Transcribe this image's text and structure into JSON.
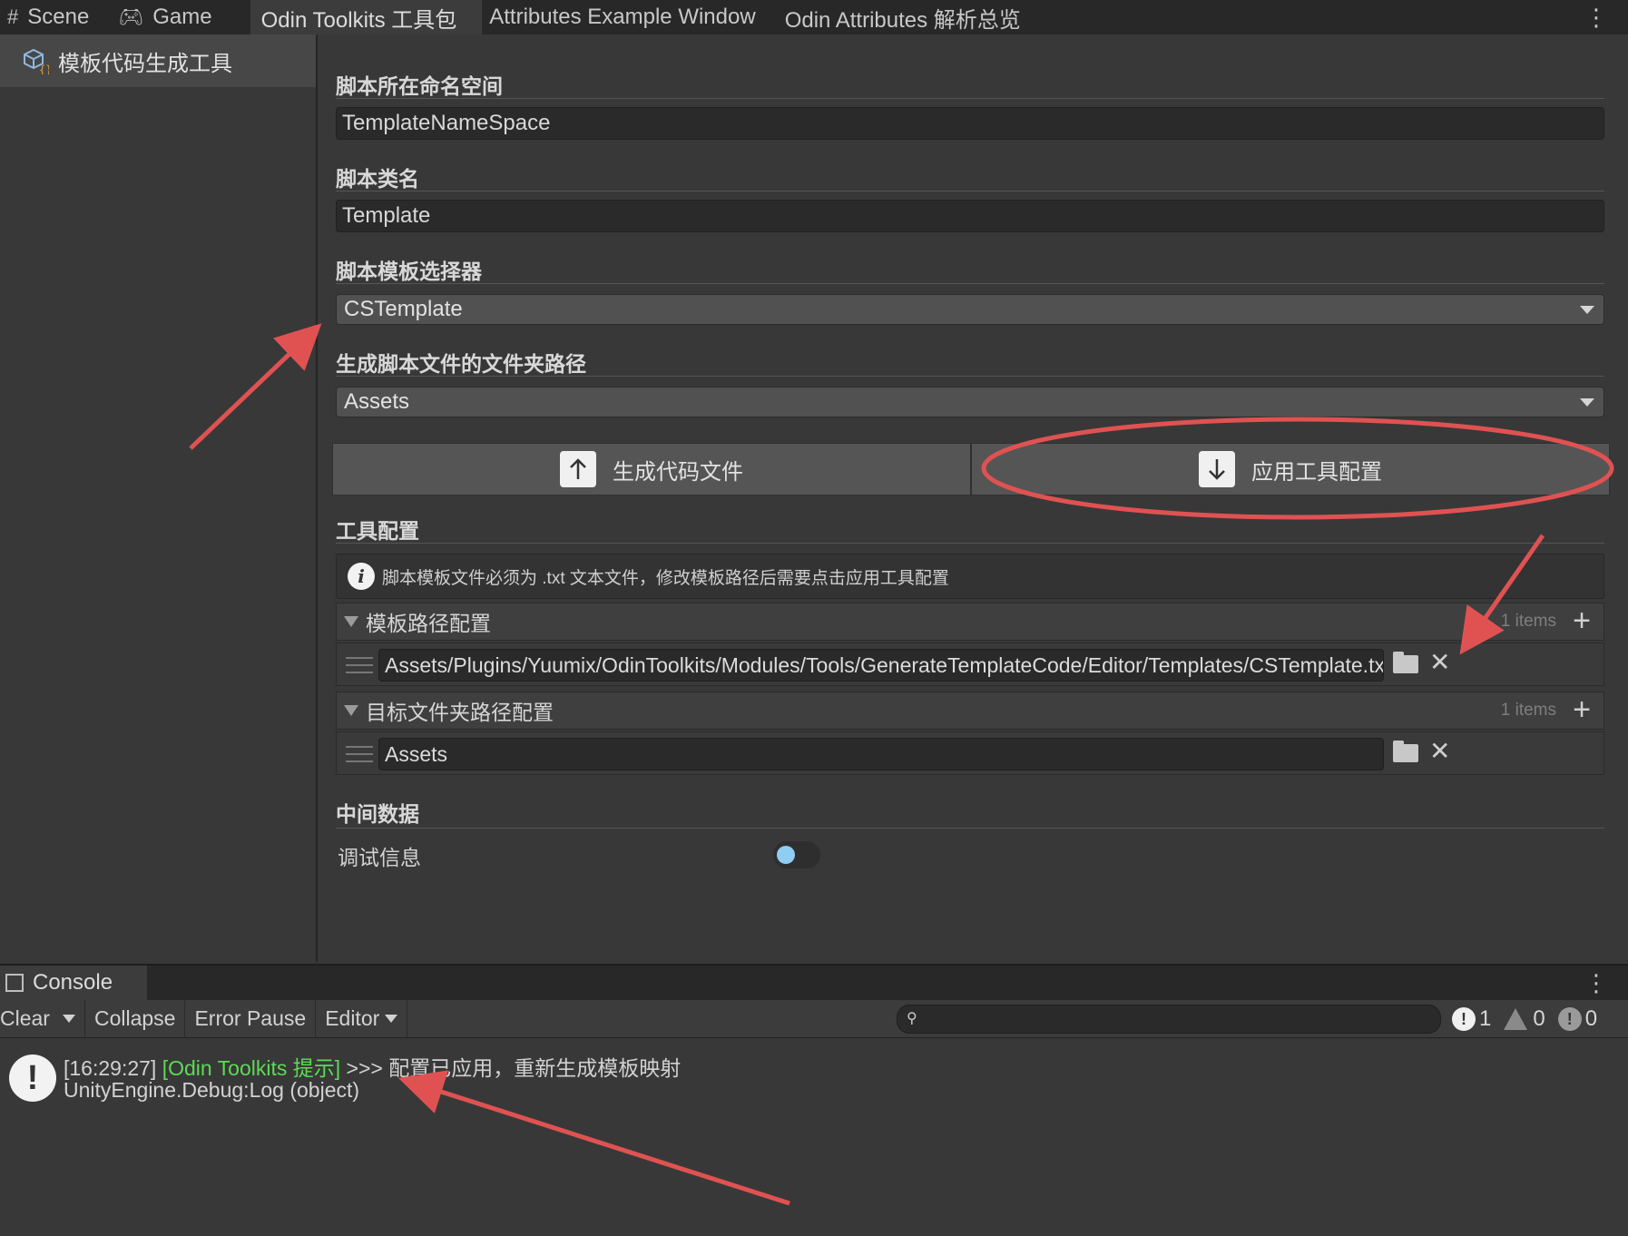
{
  "tabs": [
    {
      "label": "Scene",
      "icon": "grid-icon"
    },
    {
      "label": "Game",
      "icon": "gamepad-icon"
    },
    {
      "label": "Odin Toolkits 工具包",
      "active": true
    },
    {
      "label": "Attributes Example Window"
    },
    {
      "label": "Odin Attributes 解析总览"
    }
  ],
  "sidebar": {
    "items": [
      {
        "label": "模板代码生成工具",
        "icon": "cube-code-icon",
        "selected": true
      }
    ]
  },
  "main": {
    "namespace": {
      "label": "脚本所在命名空间",
      "value": "TemplateNameSpace"
    },
    "classname": {
      "label": "脚本类名",
      "value": "Template"
    },
    "template_selector": {
      "label": "脚本模板选择器",
      "value": "CSTemplate"
    },
    "output_folder": {
      "label": "生成脚本文件的文件夹路径",
      "value": "Assets"
    },
    "buttons": {
      "generate": "生成代码文件",
      "apply": "应用工具配置"
    },
    "config": {
      "title": "工具配置",
      "info": "脚本模板文件必须为 .txt 文本文件，修改模板路径后需要点击应用工具配置",
      "template_paths": {
        "label": "模板路径配置",
        "count": "1 items",
        "items": [
          "Assets/Plugins/Yuumix/OdinToolkits/Modules/Tools/GenerateTemplateCode/Editor/Templates/CSTemplate.txt"
        ]
      },
      "target_paths": {
        "label": "目标文件夹路径配置",
        "count": "1 items",
        "items": [
          "Assets"
        ]
      }
    },
    "intermediate": {
      "title": "中间数据",
      "debug_label": "调试信息",
      "debug_enabled": false
    }
  },
  "console": {
    "tab": "Console",
    "toolbar": {
      "clear": "Clear",
      "collapse": "Collapse",
      "error_pause": "Error Pause",
      "editor": "Editor"
    },
    "search_placeholder": "",
    "counts": {
      "log": "1",
      "warn": "0",
      "error": "0"
    },
    "entries": [
      {
        "time": "[16:29:27]",
        "tag": "[Odin Toolkits 提示]",
        "message": ">>> 配置已应用，重新生成模板映射",
        "stack": "UnityEngine.Debug:Log (object)"
      }
    ]
  },
  "colors": {
    "annotation": "#e05252",
    "log_tag": "#5bdc55",
    "toggle_knob": "#8fcdf3"
  }
}
